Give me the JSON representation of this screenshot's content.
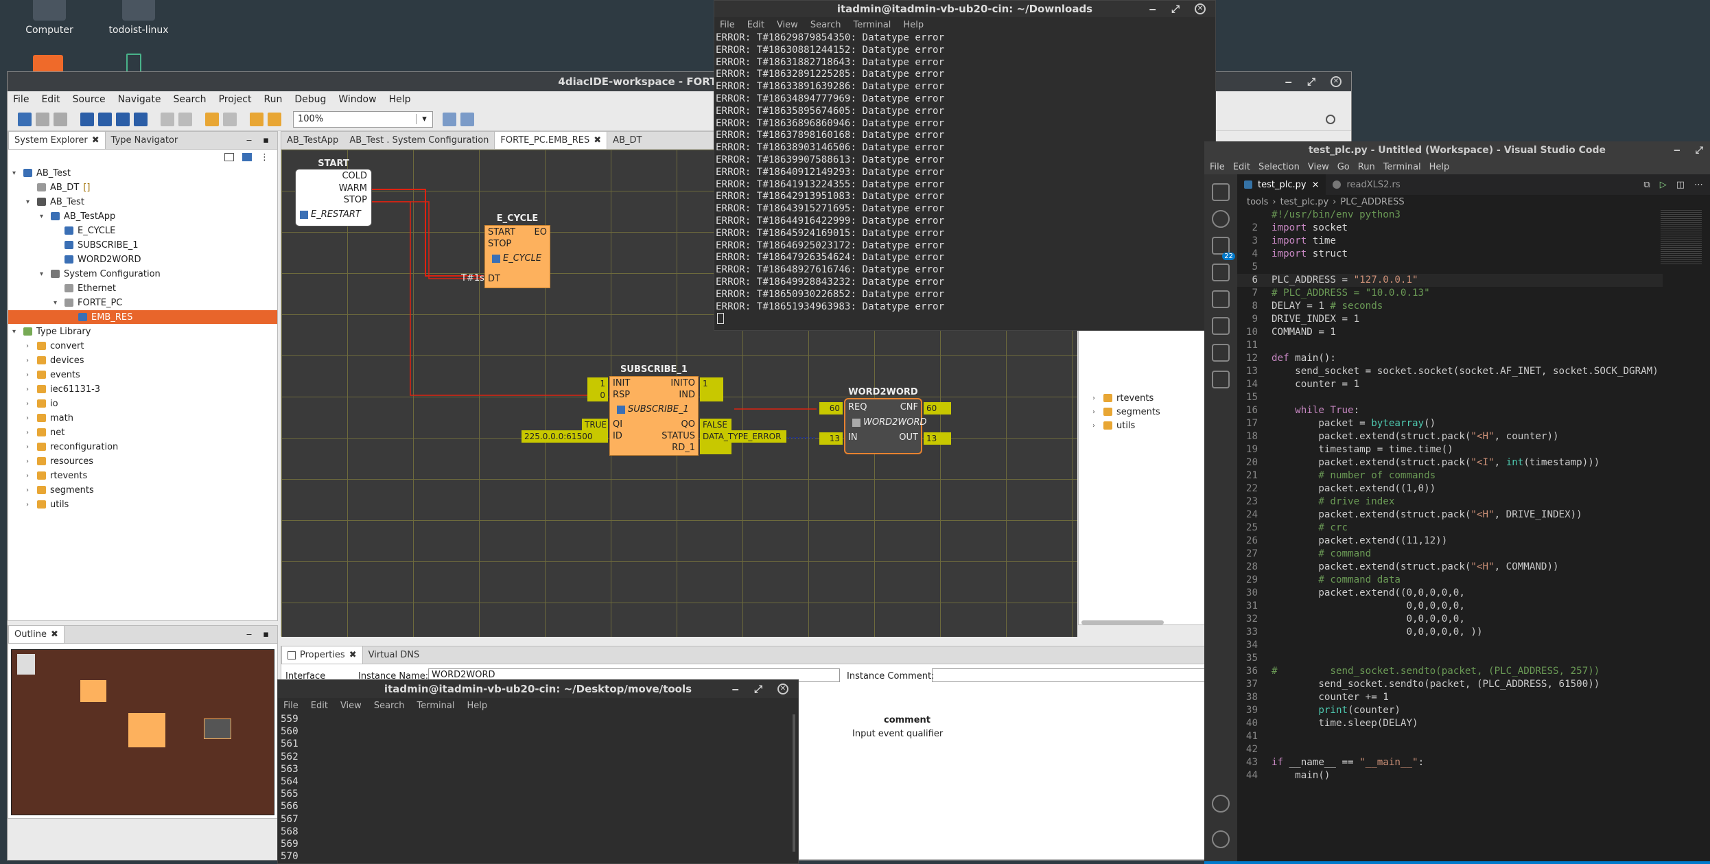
{
  "desktop": {
    "icons": [
      {
        "label": "Computer"
      },
      {
        "label": "todoist-linux"
      }
    ]
  },
  "eclipse": {
    "title": "4diacIDE-workspace - FORTE_PC.EMB_RES",
    "menu": [
      "File",
      "Edit",
      "Source",
      "Navigate",
      "Search",
      "Project",
      "Run",
      "Debug",
      "Window",
      "Help"
    ],
    "zoom": "100%",
    "left_tabs": {
      "system_explorer": "System Explorer",
      "type_navigator": "Type Navigator"
    },
    "tree": [
      {
        "label": "AB_Test",
        "level": 0,
        "icon": "project"
      },
      {
        "label": "AB_DT",
        "level": 1,
        "icon": "file",
        "suffix": "[]"
      },
      {
        "label": "AB_Test",
        "level": 1,
        "icon": "system"
      },
      {
        "label": "AB_TestApp",
        "level": 2,
        "icon": "app"
      },
      {
        "label": "E_CYCLE",
        "level": 3,
        "icon": "fb"
      },
      {
        "label": "SUBSCRIBE_1",
        "level": 3,
        "icon": "fb"
      },
      {
        "label": "WORD2WORD",
        "level": 3,
        "icon": "fb"
      },
      {
        "label": "System Configuration",
        "level": 2,
        "icon": "syscfg"
      },
      {
        "label": "Ethernet",
        "level": 3,
        "icon": "net"
      },
      {
        "label": "FORTE_PC",
        "level": 3,
        "icon": "device"
      },
      {
        "label": "EMB_RES",
        "level": 4,
        "icon": "res",
        "selected": true
      },
      {
        "label": "Type Library",
        "level": 0,
        "icon": "lib"
      },
      {
        "label": "convert",
        "level": 1,
        "icon": "folder"
      },
      {
        "label": "devices",
        "level": 1,
        "icon": "folder"
      },
      {
        "label": "events",
        "level": 1,
        "icon": "folder"
      },
      {
        "label": "iec61131-3",
        "level": 1,
        "icon": "folder"
      },
      {
        "label": "io",
        "level": 1,
        "icon": "folder"
      },
      {
        "label": "math",
        "level": 1,
        "icon": "folder"
      },
      {
        "label": "net",
        "level": 1,
        "icon": "folder"
      },
      {
        "label": "reconfiguration",
        "level": 1,
        "icon": "folder"
      },
      {
        "label": "resources",
        "level": 1,
        "icon": "folder"
      },
      {
        "label": "rtevents",
        "level": 1,
        "icon": "folder"
      },
      {
        "label": "segments",
        "level": 1,
        "icon": "folder"
      },
      {
        "label": "utils",
        "level": 1,
        "icon": "folder"
      }
    ],
    "outline_tab": "Outline",
    "editor_tabs": [
      "AB_TestApp",
      "AB_Test . System Configuration",
      "FORTE_PC.EMB_RES",
      "AB_DT"
    ],
    "fbs": {
      "start": {
        "name": "START",
        "outs": [
          "COLD",
          "WARM",
          "STOP"
        ],
        "type": "E_RESTART"
      },
      "ecycle": {
        "name": "E_CYCLE",
        "ins": [
          "START",
          "STOP"
        ],
        "out": "EO",
        "type": "E_CYCLE",
        "dt_label": "DT",
        "dt_value": "T#1s"
      },
      "subscribe": {
        "name": "SUBSCRIBE_1",
        "type": "SUBSCRIBE_1",
        "ev_in": [
          "INIT",
          "RSP"
        ],
        "ev_out": [
          "INITO",
          "IND"
        ],
        "d_in": [
          "QI",
          "ID"
        ],
        "d_out": [
          "QO",
          "STATUS",
          "RD_1"
        ],
        "vals": {
          "init": "1",
          "rsp": "0",
          "inito": "1",
          "qi": "TRUE",
          "id": "225.0.0.0:61500",
          "qo": "FALSE",
          "status": "DATA_TYPE_ERROR"
        }
      },
      "word2word": {
        "name": "WORD2WORD",
        "type": "WORD2WORD",
        "ev_in": "REQ",
        "ev_out": "CNF",
        "d_in": "IN",
        "d_out": "OUT",
        "vals": {
          "req": "60",
          "cnf": "60",
          "in": "13",
          "out": "13"
        }
      }
    },
    "right_tree": [
      "rtevents",
      "segments",
      "utils"
    ],
    "bottom_tabs": {
      "properties": "Properties",
      "virtual_dns": "Virtual DNS"
    },
    "props": {
      "instance_name_label": "Instance Name:",
      "instance_name": "WORD2WORD",
      "instance_comment_label": "Instance Comment:",
      "interface_tab": "Interface",
      "comment_header": "comment",
      "comment_value": "Input event qualifier"
    }
  },
  "terminal1": {
    "title": "itadmin@itadmin-vb-ub20-cin: ~/Downloads",
    "menu": [
      "File",
      "Edit",
      "View",
      "Search",
      "Terminal",
      "Help"
    ],
    "lines": [
      "ERROR: T#18629879854350: Datatype error",
      "ERROR: T#18630881244152: Datatype error",
      "ERROR: T#18631882718643: Datatype error",
      "ERROR: T#18632891225285: Datatype error",
      "ERROR: T#18633891639286: Datatype error",
      "ERROR: T#18634894777969: Datatype error",
      "ERROR: T#18635895674605: Datatype error",
      "ERROR: T#18636896860946: Datatype error",
      "ERROR: T#18637898160168: Datatype error",
      "ERROR: T#18638903146506: Datatype error",
      "ERROR: T#18639907588613: Datatype error",
      "ERROR: T#18640912149293: Datatype error",
      "ERROR: T#18641913224355: Datatype error",
      "ERROR: T#18642913951083: Datatype error",
      "ERROR: T#18643915271695: Datatype error",
      "ERROR: T#18644916422999: Datatype error",
      "ERROR: T#18645924169015: Datatype error",
      "ERROR: T#18646925023172: Datatype error",
      "ERROR: T#18647926354624: Datatype error",
      "ERROR: T#18648927616746: Datatype error",
      "ERROR: T#18649928843232: Datatype error",
      "ERROR: T#18650930226852: Datatype error",
      "ERROR: T#18651934963983: Datatype error"
    ]
  },
  "terminal2": {
    "title": "itadmin@itadmin-vb-ub20-cin: ~/Desktop/move/tools",
    "menu": [
      "File",
      "Edit",
      "View",
      "Search",
      "Terminal",
      "Help"
    ],
    "lines": [
      "559",
      "560",
      "561",
      "562",
      "563",
      "564",
      "565",
      "566",
      "567",
      "568",
      "569",
      "570"
    ]
  },
  "vscode": {
    "title": "test_plc.py - Untitled (Workspace) - Visual Studio Code",
    "menu": [
      "File",
      "Edit",
      "Selection",
      "View",
      "Go",
      "Run",
      "Terminal",
      "Help"
    ],
    "tabs": [
      {
        "label": "test_plc.py",
        "active": true
      },
      {
        "label": "readXLS2.rs",
        "active": false
      }
    ],
    "breadcrumb": [
      "tools",
      "test_plc.py",
      "PLC_ADDRESS"
    ],
    "scm_badge": "22",
    "lines": [
      {
        "n": "",
        "t": "#!/usr/bin/env python3",
        "c": "com"
      },
      {
        "n": "2",
        "t": "import socket"
      },
      {
        "n": "3",
        "t": "import time"
      },
      {
        "n": "4",
        "t": "import struct"
      },
      {
        "n": "5",
        "t": ""
      },
      {
        "n": "6",
        "t": "PLC_ADDRESS = \"127.0.0.1\""
      },
      {
        "n": "7",
        "t": "# PLC_ADDRESS = \"10.0.0.13\"",
        "c": "com"
      },
      {
        "n": "8",
        "t": "DELAY = 1 # seconds"
      },
      {
        "n": "9",
        "t": "DRIVE_INDEX = 1"
      },
      {
        "n": "10",
        "t": "COMMAND = 1"
      },
      {
        "n": "11",
        "t": ""
      },
      {
        "n": "12",
        "t": "def main():"
      },
      {
        "n": "13",
        "t": "    send_socket = socket.socket(socket.AF_INET, socket.SOCK_DGRAM)"
      },
      {
        "n": "14",
        "t": "    counter = 1"
      },
      {
        "n": "15",
        "t": ""
      },
      {
        "n": "16",
        "t": "    while True:"
      },
      {
        "n": "17",
        "t": "        packet = bytearray()"
      },
      {
        "n": "18",
        "t": "        packet.extend(struct.pack(\"<H\", counter))"
      },
      {
        "n": "19",
        "t": "        timestamp = time.time()"
      },
      {
        "n": "20",
        "t": "        packet.extend(struct.pack(\"<I\", int(timestamp)))"
      },
      {
        "n": "21",
        "t": "        # number of commands",
        "c": "com"
      },
      {
        "n": "22",
        "t": "        packet.extend((1,0))"
      },
      {
        "n": "23",
        "t": "        # drive index",
        "c": "com"
      },
      {
        "n": "24",
        "t": "        packet.extend(struct.pack(\"<H\", DRIVE_INDEX))"
      },
      {
        "n": "25",
        "t": "        # crc",
        "c": "com"
      },
      {
        "n": "26",
        "t": "        packet.extend((11,12))"
      },
      {
        "n": "27",
        "t": "        # command",
        "c": "com"
      },
      {
        "n": "28",
        "t": "        packet.extend(struct.pack(\"<H\", COMMAND))"
      },
      {
        "n": "29",
        "t": "        # command data",
        "c": "com"
      },
      {
        "n": "30",
        "t": "        packet.extend((0,0,0,0,0,"
      },
      {
        "n": "31",
        "t": "                       0,0,0,0,0,"
      },
      {
        "n": "32",
        "t": "                       0,0,0,0,0,"
      },
      {
        "n": "33",
        "t": "                       0,0,0,0,0, ))"
      },
      {
        "n": "34",
        "t": ""
      },
      {
        "n": "35",
        "t": ""
      },
      {
        "n": "36",
        "t": "#         send_socket.sendto(packet, (PLC_ADDRESS, 257))",
        "c": "com"
      },
      {
        "n": "37",
        "t": "        send_socket.sendto(packet, (PLC_ADDRESS, 61500))"
      },
      {
        "n": "38",
        "t": "        counter += 1"
      },
      {
        "n": "39",
        "t": "        print(counter)"
      },
      {
        "n": "40",
        "t": "        time.sleep(DELAY)"
      },
      {
        "n": "41",
        "t": ""
      },
      {
        "n": "42",
        "t": ""
      },
      {
        "n": "43",
        "t": "if __name__ == \"__main__\":"
      },
      {
        "n": "44",
        "t": "    main()"
      }
    ]
  },
  "colors": {
    "desktop": "#2e3a42",
    "fb_fill": "#fdb15d",
    "value_box": "#c8c800",
    "selection": "#e8652b",
    "vscode_bg": "#1e1e1e",
    "terminal_bg": "#2d2d2d"
  }
}
